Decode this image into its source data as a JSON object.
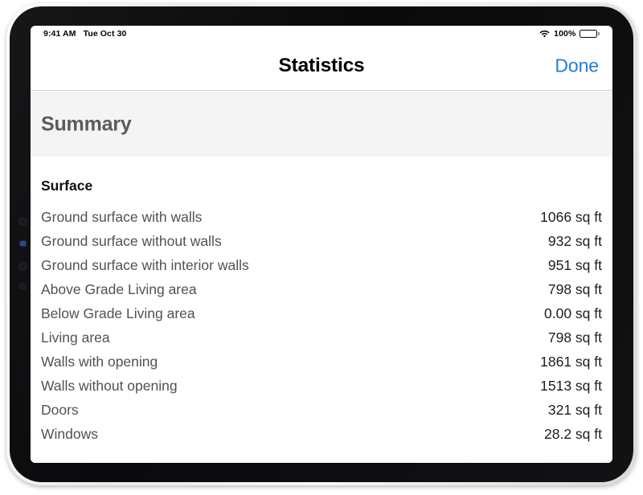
{
  "status_bar": {
    "time": "9:41 AM",
    "date": "Tue Oct 30",
    "wifi_icon": "wifi-icon",
    "battery_percent": "100%",
    "battery_icon": "battery-full-icon"
  },
  "nav_bar": {
    "title": "Statistics",
    "done_label": "Done",
    "done_color": "#1f7fd4"
  },
  "summary": {
    "heading": "Summary",
    "band_color": "#f4f4f4",
    "heading_color": "#5b5b5b"
  },
  "content": {
    "section_heading": "Surface",
    "rows": [
      {
        "label": "Ground surface with walls",
        "value": "1066 sq ft"
      },
      {
        "label": "Ground surface without walls",
        "value": "932 sq ft"
      },
      {
        "label": "Ground surface with interior walls",
        "value": "951 sq ft"
      },
      {
        "label": "Above Grade Living area",
        "value": "798 sq ft"
      },
      {
        "label": "Below Grade Living area",
        "value": "0.00 sq ft"
      },
      {
        "label": "Living area",
        "value": "798 sq ft"
      },
      {
        "label": "Walls with opening",
        "value": "1861 sq ft"
      },
      {
        "label": "Walls without opening",
        "value": "1513 sq ft"
      },
      {
        "label": "Doors",
        "value": "321 sq ft"
      },
      {
        "label": "Windows",
        "value": "28.2 sq ft"
      }
    ]
  }
}
